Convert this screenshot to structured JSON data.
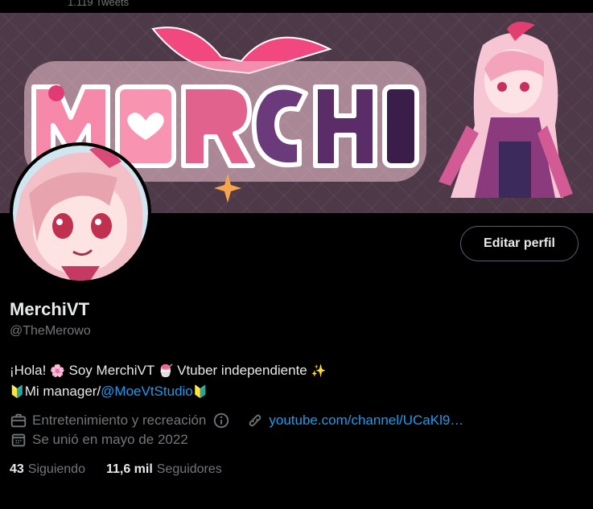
{
  "header": {
    "tweet_count": "1.119 Tweets"
  },
  "banner": {
    "title_text": "MERCHI"
  },
  "profile": {
    "edit_button_label": "Editar perfil",
    "display_name": "MerchiVT",
    "handle": "@TheMerowo",
    "bio": {
      "line1_part1": "¡Hola!",
      "line1_emoji1": "🌸",
      "line1_part2": "Soy MerchiVT",
      "line1_emoji2": "🍧",
      "line1_part3": "Vtuber independiente",
      "line1_emoji3": "✨",
      "line2_emoji1": "🔰",
      "line2_part1": "Mi manager/",
      "line2_mention": "@MoeVtStudio",
      "line2_emoji2": "🔰"
    },
    "category": "Entretenimiento y recreación",
    "website": "youtube.com/channel/UCaKl9…",
    "joined": "Se unió en mayo de 2022",
    "following_count": "43",
    "following_label": "Siguiendo",
    "followers_count": "11,6 mil",
    "followers_label": "Seguidores"
  },
  "colors": {
    "background": "#000000",
    "accent": "#1d9bf0",
    "muted": "#71767b",
    "text": "#e7e9ea",
    "banner_bg": "#4d3948",
    "banner_pink": "#f46b9e"
  }
}
